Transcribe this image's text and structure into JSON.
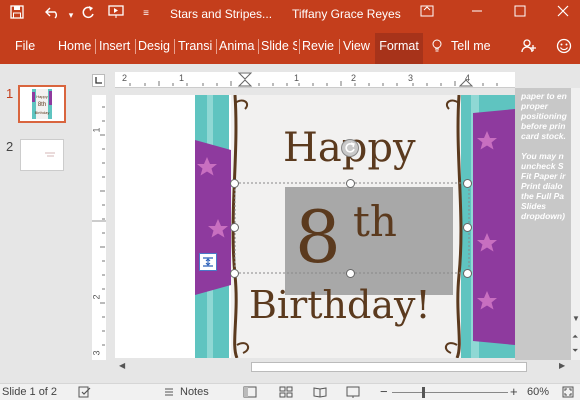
{
  "titlebar": {
    "doc_title": "Stars and Stripes...",
    "user_name": "Tiffany Grace Reyes",
    "icons": [
      "save-icon",
      "undo-icon",
      "redo-icon",
      "present-icon",
      "customize-icon",
      "restore-icon",
      "minimize-icon",
      "maximize-icon",
      "close-icon"
    ]
  },
  "ribbon": {
    "tabs": [
      "File",
      "Home",
      "Insert",
      "Design",
      "Transitions",
      "Animations",
      "Slide Show",
      "Review",
      "View",
      "Format"
    ],
    "tab_display": [
      "File",
      "Home",
      "Insert",
      "Desig",
      "Transi",
      "Anima",
      "Slide S",
      "Revie",
      "View",
      "Format"
    ],
    "active_tab": "Format",
    "tell_me": "Tell me",
    "share_icon": "add-person-icon",
    "collapse_icon": "smiley-icon"
  },
  "thumbnails": [
    {
      "num": "1",
      "selected": true
    },
    {
      "num": "2",
      "selected": false
    }
  ],
  "ruler": {
    "h_numbers": [
      "2",
      "1",
      "1",
      "2",
      "3",
      "4"
    ],
    "v_numbers": [
      "1",
      "2",
      "3"
    ]
  },
  "slide": {
    "line1": "Happy",
    "line2a": "8",
    "line2b": "th",
    "line3": "Birthday!"
  },
  "notes_text": "Print on cardstock paper to ensure proper positioning before printing card stock. You may need to uncheck Scale to Fit Paper in the Print dialog box in the Full Page Slides dropdown)",
  "notes_visible_lines": [
    "paper to en",
    "proper",
    "positioning",
    "before prin",
    "card stock.",
    "",
    "You may n",
    "uncheck S",
    "Fit Paper ir",
    "Print dialo",
    "the Full Pa",
    "Slides",
    "dropdown)"
  ],
  "status": {
    "slide_info": "Slide 1 of 2",
    "notes_label": "Notes",
    "zoom": "60%",
    "zoom_level_percent": 60
  },
  "colors": {
    "accent": "#c43e1c",
    "accent_dark": "#a7331a",
    "purple": "#8e3a9e",
    "teal": "#5fc4c0",
    "brown": "#5b3a1e"
  }
}
